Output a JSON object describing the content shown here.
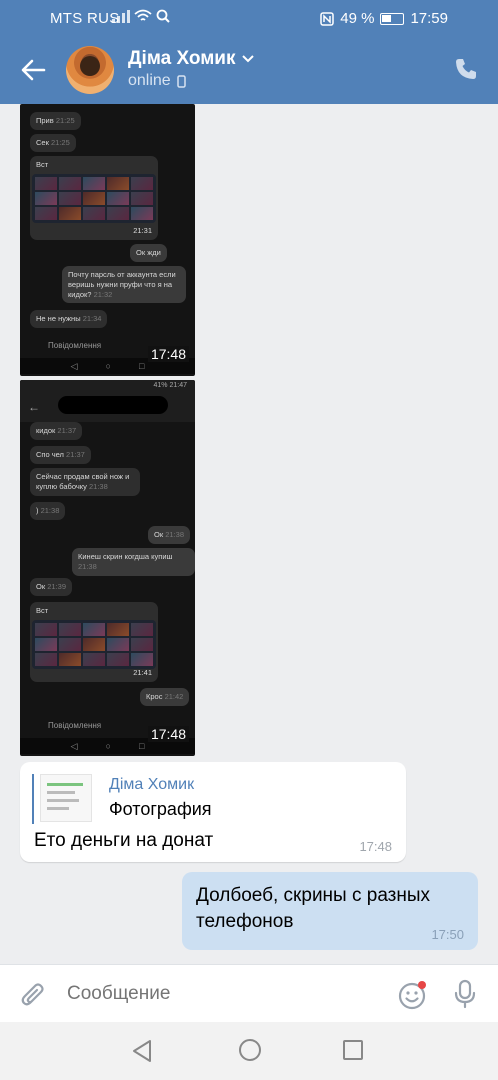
{
  "status_bar": {
    "carrier": "MTS RUS",
    "battery": "49 %",
    "time": "17:59"
  },
  "header": {
    "name": "Діма Хомик",
    "status": "online"
  },
  "screenshot1": {
    "messages": [
      {
        "text": "Прив",
        "time": "21:25",
        "dir": "in"
      },
      {
        "text": "Сек",
        "time": "21:25",
        "dir": "in"
      },
      {
        "text": "Вст",
        "time": "",
        "dir": "in"
      },
      {
        "text": "Ок жди",
        "time": "",
        "dir": "out"
      },
      {
        "text": "Почту парсль от аккаунта если веришь нужни пруфи что я на кидок?",
        "time": "21:32",
        "dir": "out"
      },
      {
        "text": "Не не нужны",
        "time": "21:34",
        "dir": "in"
      }
    ],
    "grid_time": "21:31",
    "input_placeholder": "Повідомлення",
    "overlay_time": "17:48"
  },
  "screenshot2": {
    "status": "41% 21:47",
    "messages": [
      {
        "text": "кидок",
        "time": "21:37",
        "dir": "in"
      },
      {
        "text": "Спо чел",
        "time": "21:37",
        "dir": "in"
      },
      {
        "text": "Сейчас продам свой нож и куплю бабочку",
        "time": "21:38",
        "dir": "in"
      },
      {
        "text": ")",
        "time": "21:38",
        "dir": "in"
      },
      {
        "text": "Ок",
        "time": "21:38",
        "dir": "out"
      },
      {
        "text": "Кинеш скрин когдша купиш",
        "time": "21:38",
        "dir": "out"
      },
      {
        "text": "Ок",
        "time": "21:39",
        "dir": "in"
      },
      {
        "text": "Вст",
        "time": "",
        "dir": "in"
      },
      {
        "text": "Крос",
        "time": "21:42",
        "dir": "out"
      }
    ],
    "grid_time": "21:41",
    "input_placeholder": "Повідомлення",
    "overlay_time": "17:48"
  },
  "reply_message": {
    "sender": "Діма Хомик",
    "attachment_label": "Фотография",
    "text": "Ето деньги на донат",
    "time": "17:48"
  },
  "outgoing_message": {
    "text": "Долбоеб, скрины с разных телефонов",
    "time": "17:50"
  },
  "composer": {
    "placeholder": "Сообщение"
  }
}
